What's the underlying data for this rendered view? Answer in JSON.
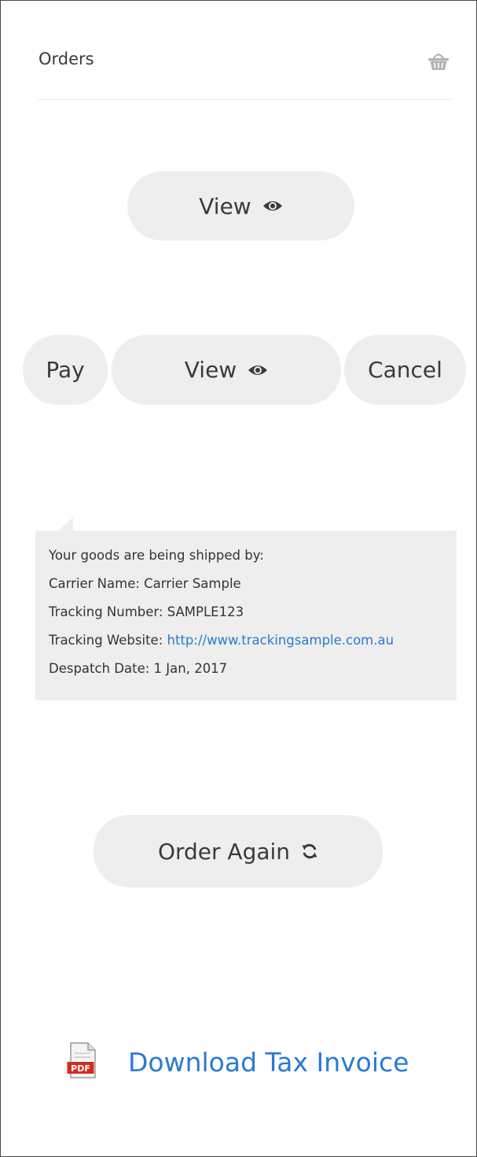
{
  "header": {
    "title": "Orders",
    "icon": "basket-icon"
  },
  "actions_top": {
    "view_label": "View",
    "view_icon": "eye-icon"
  },
  "actions_row": {
    "pay_label": "Pay",
    "view_label": "View",
    "view_icon": "eye-icon",
    "cancel_label": "Cancel"
  },
  "shipping": {
    "intro": "Your goods are being shipped by:",
    "carrier": "Carrier Name: Carrier Sample",
    "tracking_number": "Tracking Number: SAMPLE123",
    "tracking_website_label": "Tracking Website: ",
    "tracking_website_url": "http://www.trackingsample.com.au",
    "despatch_date": "Despatch Date: 1 Jan, 2017"
  },
  "reorder": {
    "label": "Order Again",
    "icon": "refresh-icon"
  },
  "invoice": {
    "label": "Download Tax Invoice",
    "icon_text": "PDF",
    "icon": "pdf-icon"
  },
  "colors": {
    "pill_bg": "#eeeeee",
    "link": "#2a7ad4",
    "pdf_red": "#d42b1f"
  }
}
